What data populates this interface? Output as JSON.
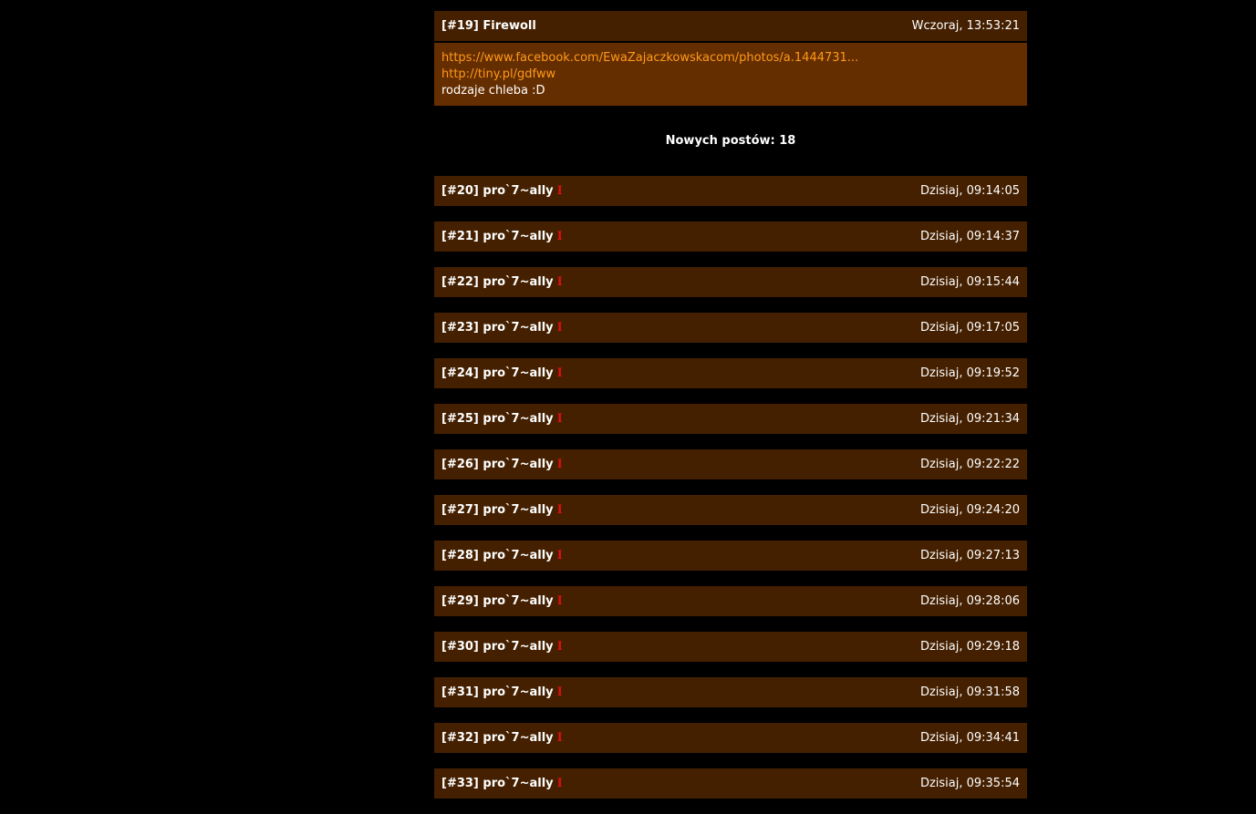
{
  "first_post": {
    "title": "[#19] Firewoll",
    "date": "Wczoraj, 13:53:21",
    "link1": "https://www.facebook.com/EwaZajaczkowskacom/photos/a.1444731...",
    "link2": "http://tiny.pl/gdfww",
    "text": "rodzaje chleba :D"
  },
  "new_posts_label": "Nowych postów: 18",
  "rank_glyph": "I",
  "posts": [
    {
      "title": "[#20] pro`7~ally",
      "date": "Dzisiaj, 09:14:05"
    },
    {
      "title": "[#21] pro`7~ally",
      "date": "Dzisiaj, 09:14:37"
    },
    {
      "title": "[#22] pro`7~ally",
      "date": "Dzisiaj, 09:15:44"
    },
    {
      "title": "[#23] pro`7~ally",
      "date": "Dzisiaj, 09:17:05"
    },
    {
      "title": "[#24] pro`7~ally",
      "date": "Dzisiaj, 09:19:52"
    },
    {
      "title": "[#25] pro`7~ally",
      "date": "Dzisiaj, 09:21:34"
    },
    {
      "title": "[#26] pro`7~ally",
      "date": "Dzisiaj, 09:22:22"
    },
    {
      "title": "[#27] pro`7~ally",
      "date": "Dzisiaj, 09:24:20"
    },
    {
      "title": "[#28] pro`7~ally",
      "date": "Dzisiaj, 09:27:13"
    },
    {
      "title": "[#29] pro`7~ally",
      "date": "Dzisiaj, 09:28:06"
    },
    {
      "title": "[#30] pro`7~ally",
      "date": "Dzisiaj, 09:29:18"
    },
    {
      "title": "[#31] pro`7~ally",
      "date": "Dzisiaj, 09:31:58"
    },
    {
      "title": "[#32] pro`7~ally",
      "date": "Dzisiaj, 09:34:41"
    },
    {
      "title": "[#33] pro`7~ally",
      "date": "Dzisiaj, 09:35:54"
    }
  ]
}
